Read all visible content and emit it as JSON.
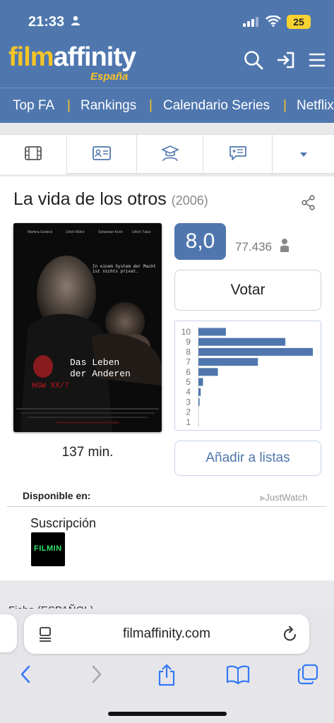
{
  "status_bar": {
    "time": "21:33",
    "battery": "25"
  },
  "header": {
    "logo_film": "film",
    "logo_affinity": "affinity",
    "logo_region": "España",
    "icons": [
      "search-icon",
      "login-icon",
      "menu-icon"
    ]
  },
  "nav": [
    "Top FA",
    "Rankings",
    "Calendario Series",
    "Netflix"
  ],
  "tabs": [
    "film-icon",
    "id-card-icon",
    "graduation-icon",
    "review-icon",
    "dropdown-icon"
  ],
  "movie": {
    "title": "La vida de los otros",
    "year": "(2006)",
    "duration": "137 min.",
    "rating": "8,0",
    "votes": "77.436",
    "poster": {
      "names": [
        "Martina Gedeck",
        "Ulrich Mühe",
        "Sebastian Koch",
        "Ulrich Tukur"
      ],
      "tagline": "In einem System der Macht ist nichts privat.",
      "title_line1": "Das Leben",
      "title_line2": "der Anderen",
      "code": "HGW XX/7"
    }
  },
  "buttons": {
    "vote": "Votar",
    "add_lists": "Añadir a listas"
  },
  "chart_data": {
    "type": "bar",
    "orientation": "horizontal",
    "categories": [
      "10",
      "9",
      "8",
      "7",
      "6",
      "5",
      "4",
      "3",
      "2",
      "1"
    ],
    "values": [
      24,
      76,
      100,
      52,
      17,
      4,
      2,
      1,
      0,
      0
    ],
    "color": "#4f77ae"
  },
  "availability": {
    "label": "Disponible en:",
    "provider_source": "JustWatch",
    "section": "Suscripción",
    "service": "FILMIN"
  },
  "peek_text": "Ficha (ESPAÑOL)",
  "browser": {
    "url": "filmaffinity.com"
  },
  "colors": {
    "brand_blue": "#4f77ae",
    "brand_yellow": "#f6c427"
  }
}
